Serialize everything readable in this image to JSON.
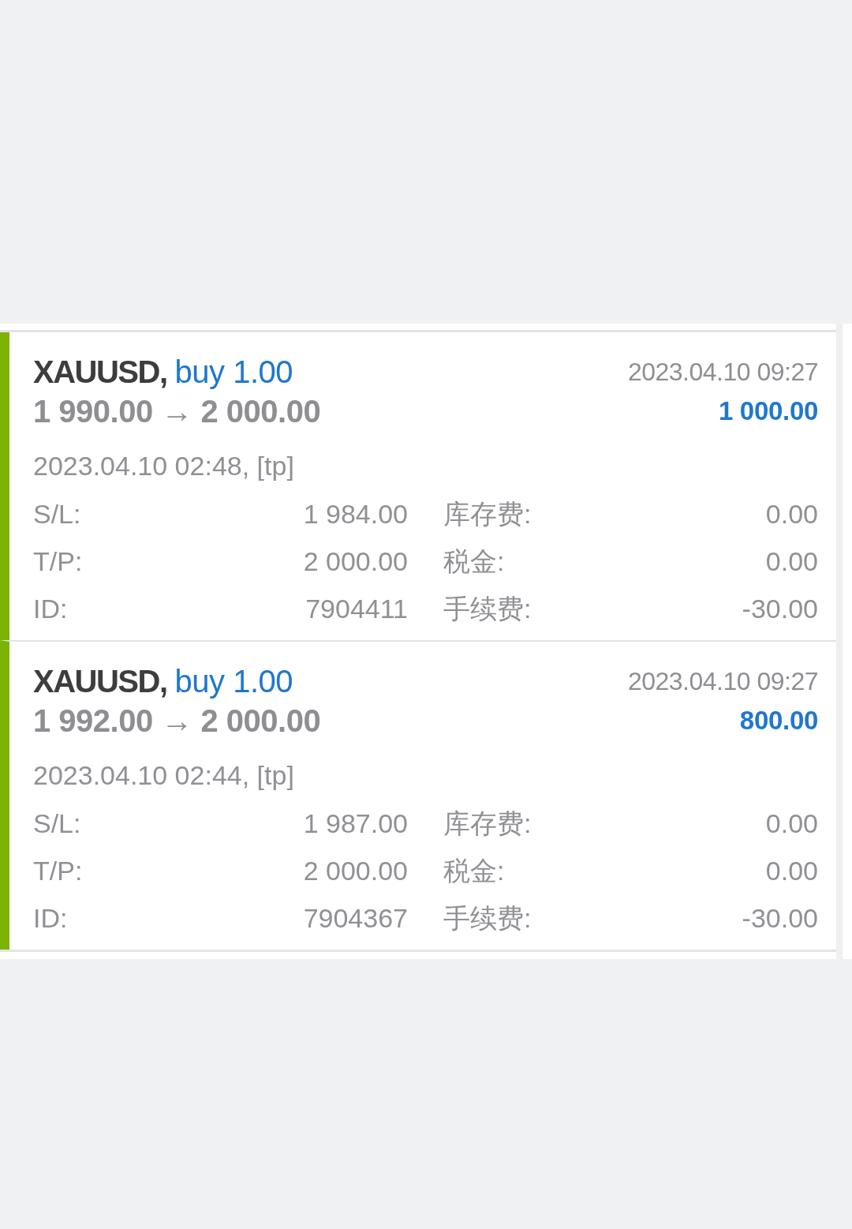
{
  "trades": [
    {
      "symbol": "XAUUSD,",
      "order": "buy 1.00",
      "prices": "1 990.00 → 2 000.00",
      "close_time": "2023.04.10 09:27",
      "profit": "1 000.00",
      "open_info": "2023.04.10 02:48, [tp]",
      "details": [
        {
          "label": "S/L:",
          "value": "1 984.00"
        },
        {
          "label": "库存费:",
          "value": "0.00"
        },
        {
          "label": "T/P:",
          "value": "2 000.00"
        },
        {
          "label": "税金:",
          "value": "0.00"
        },
        {
          "label": "ID:",
          "value": "7904411"
        },
        {
          "label": "手续费:",
          "value": "-30.00"
        }
      ]
    },
    {
      "symbol": "XAUUSD,",
      "order": "buy 1.00",
      "prices": "1 992.00 → 2 000.00",
      "close_time": "2023.04.10 09:27",
      "profit": "800.00",
      "open_info": "2023.04.10 02:44, [tp]",
      "details": [
        {
          "label": "S/L:",
          "value": "1 987.00"
        },
        {
          "label": "库存费:",
          "value": "0.00"
        },
        {
          "label": "T/P:",
          "value": "2 000.00"
        },
        {
          "label": "税金:",
          "value": "0.00"
        },
        {
          "label": "ID:",
          "value": "7904367"
        },
        {
          "label": "手续费:",
          "value": "-30.00"
        }
      ]
    }
  ]
}
